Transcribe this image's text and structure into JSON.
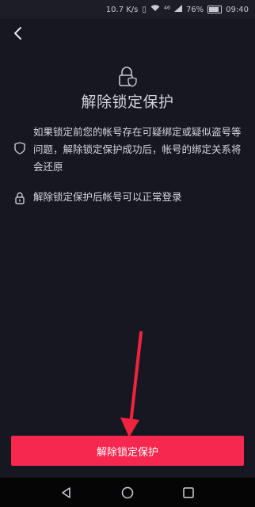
{
  "status_bar": {
    "speed": "10.7 K/s",
    "network": "⁴⁶",
    "battery": "76%",
    "battery_level": 0.76,
    "time": "09:40"
  },
  "header": {
    "back_icon": "chevron-left-icon"
  },
  "hero": {
    "icon": "lock-shield-icon",
    "title": "解除锁定保护"
  },
  "info": [
    {
      "icon": "shield-icon",
      "text": "如果锁定前您的帐号存在可疑绑定或疑似盗号等问题，解除锁定保护成功后，帐号的绑定关系将会还原"
    },
    {
      "icon": "lock-icon",
      "text": "解除锁定保护后帐号可以正常登录"
    }
  ],
  "action": {
    "button_label": "解除锁定保护",
    "button_color": "#f6284f"
  },
  "nav": {
    "back": "triangle-back-icon",
    "home": "circle-home-icon",
    "recents": "square-recents-icon"
  }
}
